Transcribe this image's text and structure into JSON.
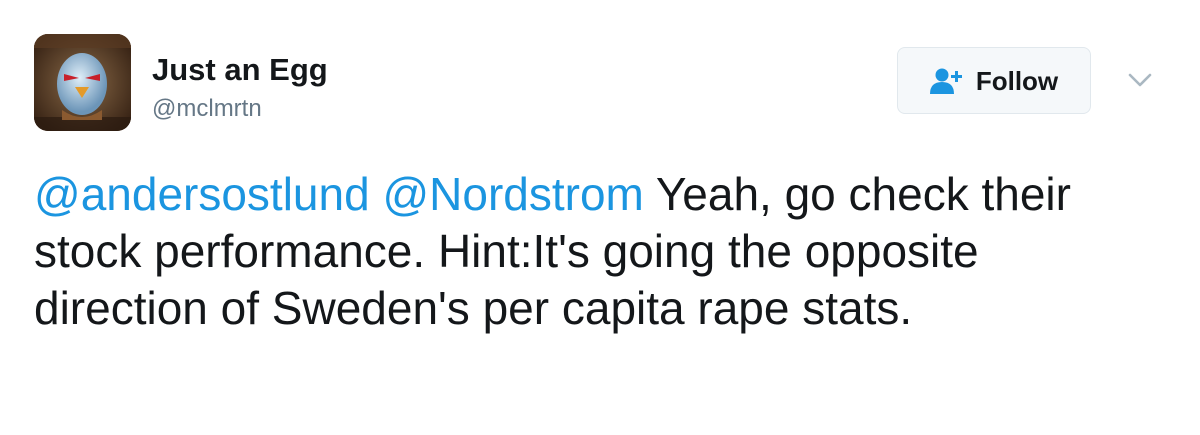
{
  "user": {
    "display_name": "Just an Egg",
    "handle": "@mclmrtn",
    "avatar_icon": "egg-warrior-avatar"
  },
  "follow_button": {
    "label": "Follow",
    "icon": "add-user-icon"
  },
  "menu": {
    "icon": "chevron-down-icon"
  },
  "tweet": {
    "mention_1": "@andersostlund",
    "mention_2": "@Nordstrom",
    "text": " Yeah, go check their stock performance.  Hint:It's going the opposite direction of Sweden's per capita rape stats."
  },
  "colors": {
    "link": "#1b95e0",
    "text": "#14171a",
    "secondary": "#657786"
  }
}
